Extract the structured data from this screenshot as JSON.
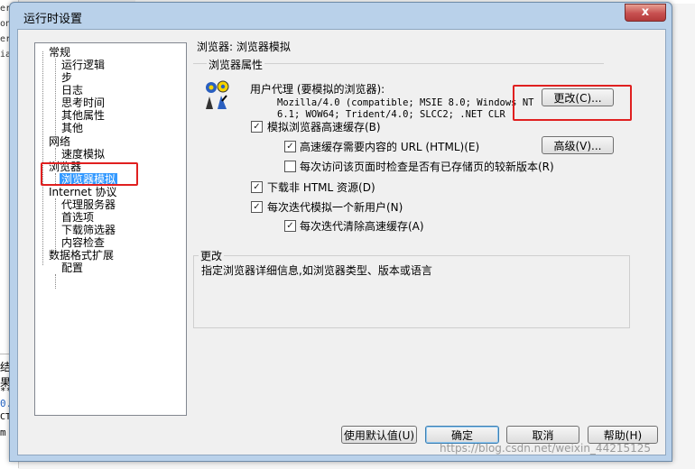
{
  "background": {
    "left_snippets": [
      "er_i",
      "on",
      "er_e",
      "ials.",
      "结果",
      "**",
      "0.",
      "CT",
      "m"
    ]
  },
  "dialog": {
    "title": "运行时设置",
    "close_glyph": "x"
  },
  "tree": {
    "items": [
      {
        "label": "常规"
      },
      {
        "label": "运行逻辑"
      },
      {
        "label": "步"
      },
      {
        "label": "日志"
      },
      {
        "label": "思考时间"
      },
      {
        "label": "其他属性"
      },
      {
        "label": "其他"
      },
      {
        "label": "网络"
      },
      {
        "label": "速度模拟"
      },
      {
        "label": "浏览器"
      },
      {
        "label": "浏览器模拟"
      },
      {
        "label": "Internet 协议"
      },
      {
        "label": "代理服务器"
      },
      {
        "label": "首选项"
      },
      {
        "label": "下载筛选器"
      },
      {
        "label": "内容检查"
      },
      {
        "label": "数据格式扩展"
      },
      {
        "label": "配置"
      }
    ],
    "selected": "浏览器模拟"
  },
  "panel": {
    "title": "浏览器: 浏览器模拟",
    "properties_group": "浏览器属性",
    "user_agent_label": "用户代理 (要模拟的浏览器):",
    "user_agent_value_line1": "Mozilla/4.0 (compatible; MSIE 8.0; Windows NT",
    "user_agent_value_line2": "6.1; WOW64; Trident/4.0; SLCC2; .NET CLR",
    "change_button": "更改(C)...",
    "simulate_cache": "模拟浏览器高速缓存(B)",
    "cache_url_content": "高速缓存需要内容的 URL (HTML)(E)",
    "advanced_button": "高级(V)...",
    "check_newer": "每次访问该页面时检查是否有已存储页的较新版本(R)",
    "download_non_html": "下载非 HTML 资源(D)",
    "new_user_each_iter": "每次迭代模拟一个新用户(N)",
    "clear_cache_each_iter": "每次迭代清除高速缓存(A)",
    "help_group": "更改",
    "help_text": "指定浏览器详细信息,如浏览器类型、版本或语言"
  },
  "buttons": {
    "defaults": "使用默认值(U)",
    "ok": "确定",
    "cancel": "取消",
    "help": "帮助(H)"
  },
  "checkbox_states": {
    "simulate_cache": true,
    "cache_url_content": true,
    "check_newer": false,
    "download_non_html": true,
    "new_user_each_iter": true,
    "clear_cache_each_iter": true
  },
  "watermark": "https://blog.csdn.net/weixin_44215125"
}
